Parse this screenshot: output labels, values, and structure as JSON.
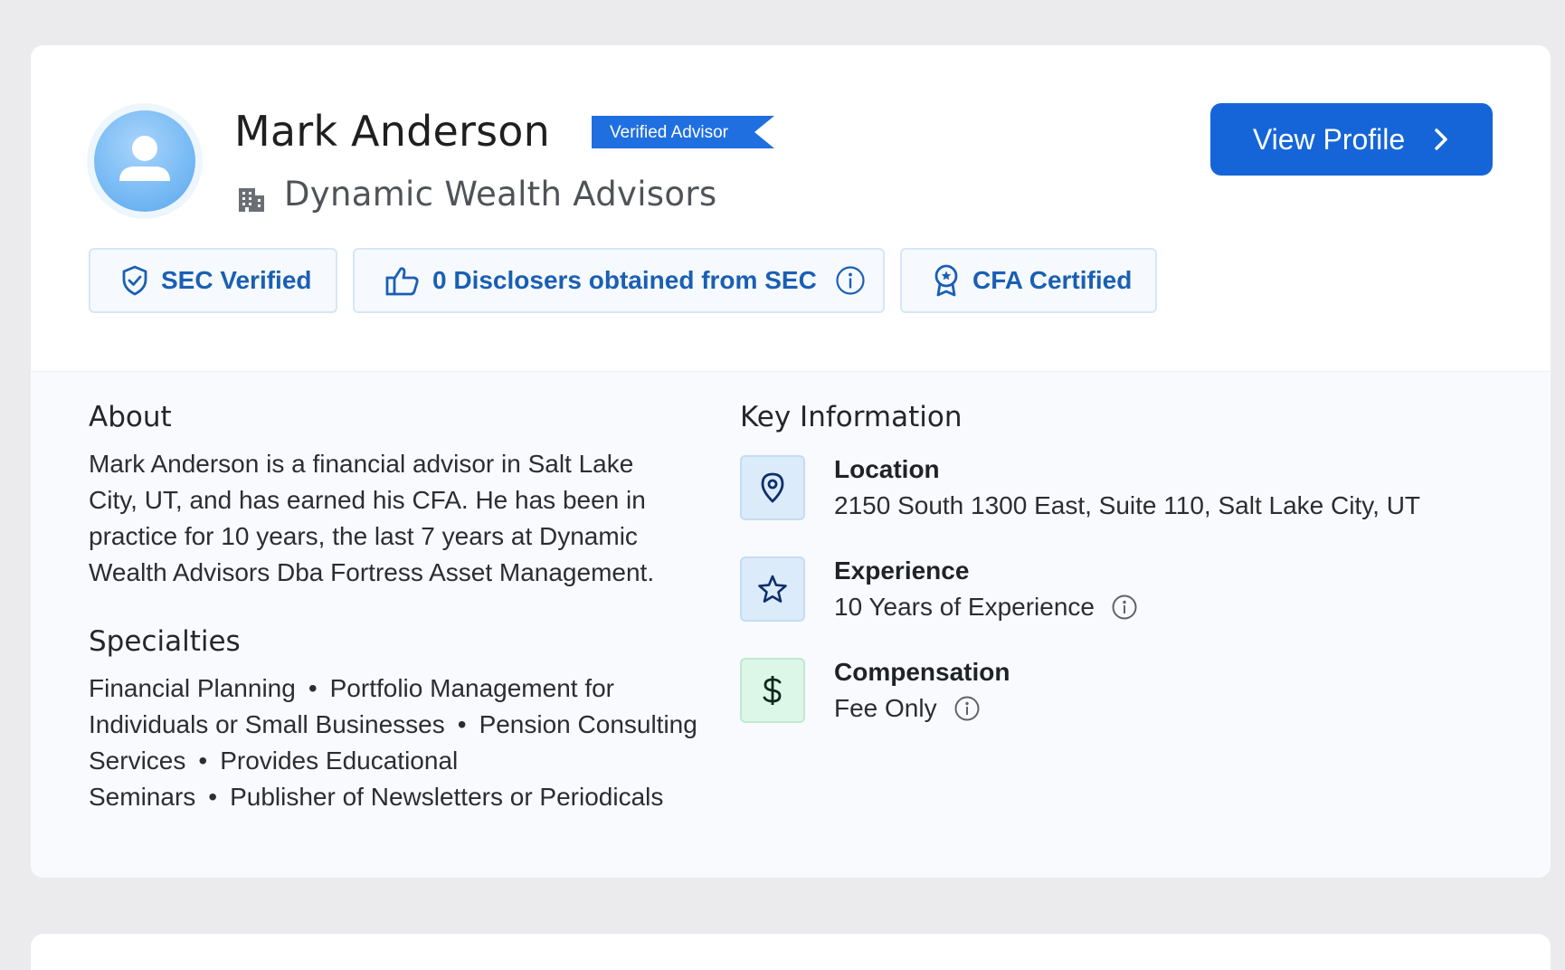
{
  "advisor": {
    "name": "Mark Anderson",
    "verified_badge": "Verified Advisor",
    "firm": "Dynamic Wealth Advisors",
    "avatar_icon": "user-icon"
  },
  "actions": {
    "view_profile": "View Profile"
  },
  "badges": [
    {
      "label": "SEC Verified",
      "icon": "shield-check-icon"
    },
    {
      "label": "0 Disclosers obtained from SEC",
      "icon": "thumbs-up-icon"
    },
    {
      "label": "CFA Certified",
      "icon": "award-icon"
    }
  ],
  "about": {
    "title": "About",
    "lines": [
      "Mark Anderson is a financial advisor in Salt Lake",
      "City, UT, and has earned his CFA. He has been in",
      "practice for 10 years, the last 7 years at Dynamic",
      "Wealth Advisors Dba Fortress Asset Management."
    ]
  },
  "specialties": {
    "title": "Specialties",
    "items": [
      "Financial Planning",
      "Portfolio Management for Individuals or Small Businesses",
      "Pension Consulting Services",
      "Provides Educational Seminars",
      "Publisher of Newsletters or Periodicals"
    ]
  },
  "key_information": {
    "title": "Key Information",
    "items": [
      {
        "label": "Location",
        "value": "2150 South 1300 East, Suite 110, Salt Lake City, UT",
        "icon": "location-pin-icon"
      },
      {
        "label": "Experience",
        "value": "10 Years of Experience",
        "icon": "star-icon"
      },
      {
        "label": "Compensation",
        "value": "Fee Only",
        "icon": "dollar-icon"
      }
    ]
  },
  "colors": {
    "primary": "#1565d8",
    "badge_text": "#1a5fb4",
    "page_bg": "#ebebed"
  }
}
